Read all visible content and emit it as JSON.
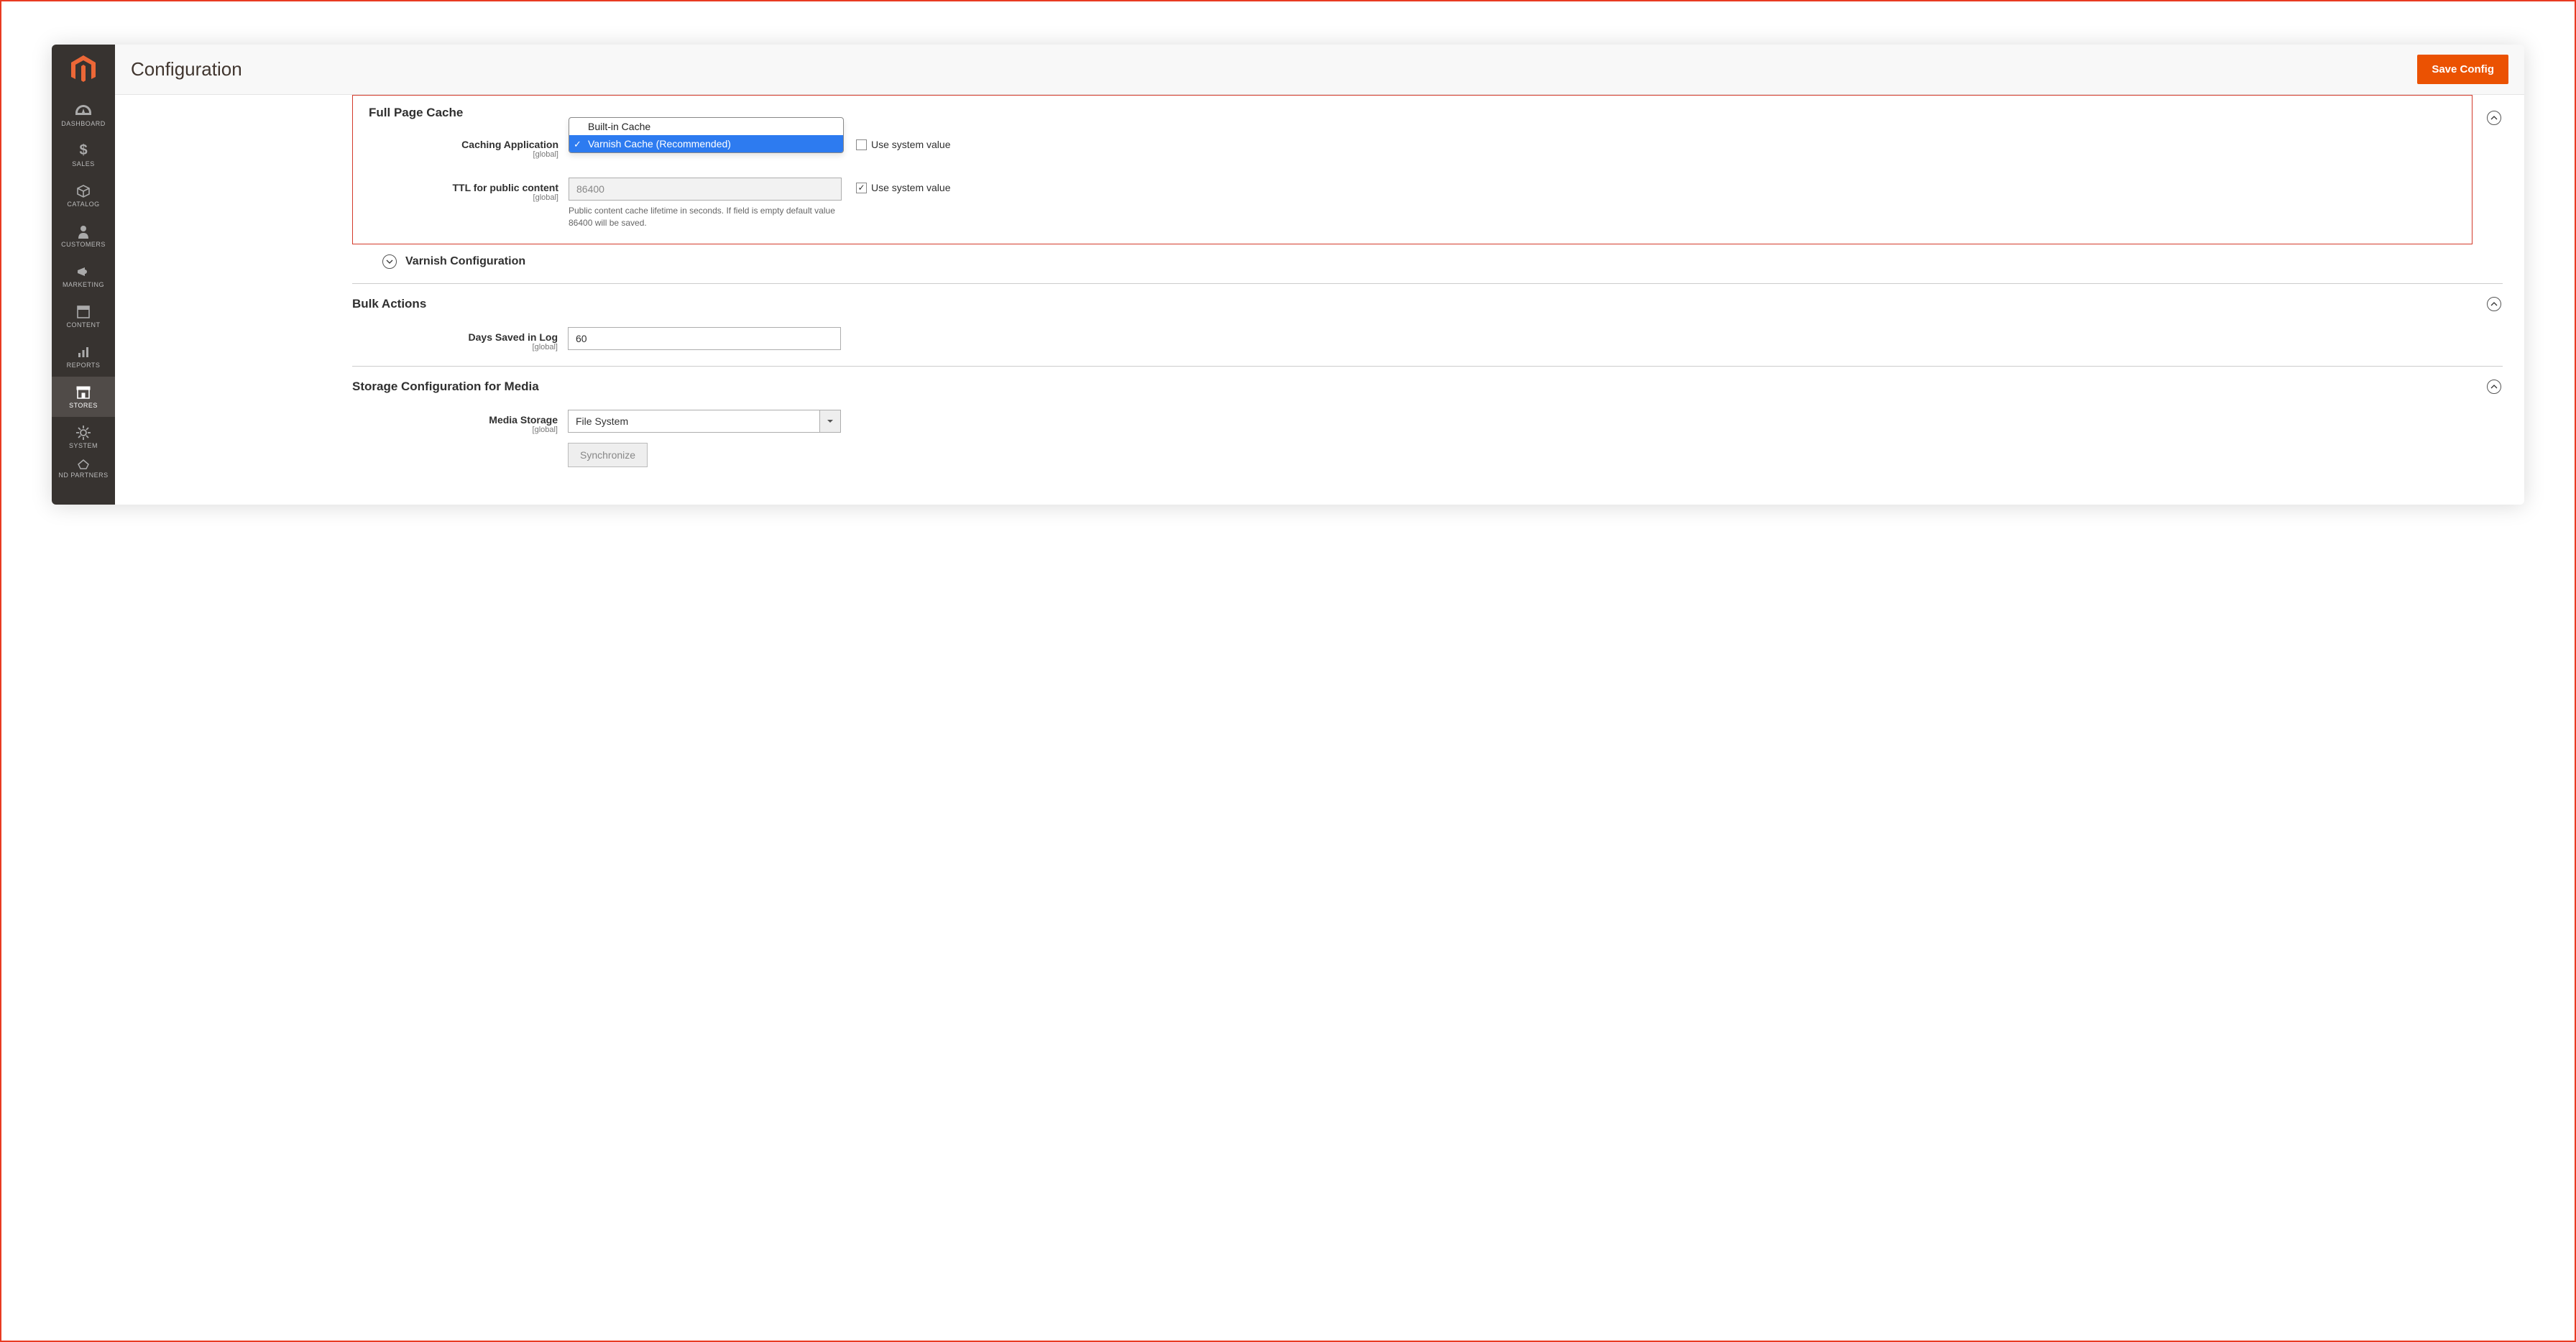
{
  "header": {
    "title": "Configuration",
    "save_btn": "Save Config"
  },
  "sidebar": {
    "items": [
      {
        "label": "DASHBOARD"
      },
      {
        "label": "SALES"
      },
      {
        "label": "CATALOG"
      },
      {
        "label": "CUSTOMERS"
      },
      {
        "label": "MARKETING"
      },
      {
        "label": "CONTENT"
      },
      {
        "label": "REPORTS"
      },
      {
        "label": "STORES"
      },
      {
        "label": "SYSTEM"
      },
      {
        "label": "ND PARTNERS"
      }
    ]
  },
  "sections": {
    "full_page_cache": {
      "title": "Full Page Cache",
      "caching_app": {
        "label": "Caching Application",
        "scope": "[global]",
        "options": [
          "Built-in Cache",
          "Varnish Cache (Recommended)"
        ],
        "selected": "Varnish Cache (Recommended)",
        "use_system_label": "Use system value",
        "use_system_checked": false
      },
      "ttl": {
        "label": "TTL for public content",
        "scope": "[global]",
        "value": "86400",
        "help": "Public content cache lifetime in seconds. If field is empty default value 86400 will be saved.",
        "use_system_label": "Use system value",
        "use_system_checked": true
      },
      "varnish_config_title": "Varnish Configuration"
    },
    "bulk_actions": {
      "title": "Bulk Actions",
      "days_in_log": {
        "label": "Days Saved in Log",
        "scope": "[global]",
        "value": "60"
      }
    },
    "storage_media": {
      "title": "Storage Configuration for Media",
      "media_storage": {
        "label": "Media Storage",
        "scope": "[global]",
        "value": "File System"
      },
      "sync_btn": "Synchronize"
    }
  }
}
